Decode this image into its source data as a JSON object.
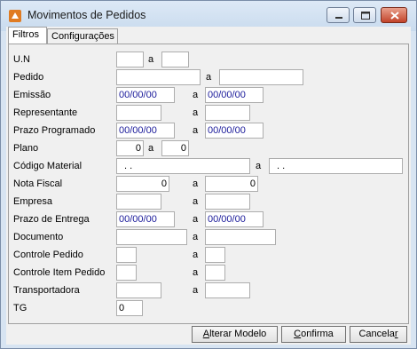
{
  "window": {
    "title": "Movimentos de Pedidos"
  },
  "tabs": [
    {
      "label": "Filtros",
      "active": true
    },
    {
      "label": "Configurações",
      "active": false
    }
  ],
  "range_separator": "a",
  "form": {
    "un": {
      "label": "U.N",
      "from": "",
      "to": ""
    },
    "pedido": {
      "label": "Pedido",
      "from": "",
      "to": ""
    },
    "emissao": {
      "label": "Emissão",
      "from": "00/00/00",
      "to": "00/00/00"
    },
    "representante": {
      "label": "Representante",
      "from": "",
      "to": ""
    },
    "prazo_programado": {
      "label": "Prazo Programado",
      "from": "00/00/00",
      "to": "00/00/00"
    },
    "plano": {
      "label": "Plano",
      "from": "0",
      "to": "0"
    },
    "codigo_material": {
      "label": "Código Material",
      "from": ".  .",
      "to": ".  ."
    },
    "nota_fiscal": {
      "label": "Nota Fiscal",
      "from": "0",
      "to": "0"
    },
    "empresa": {
      "label": "Empresa",
      "from": "",
      "to": ""
    },
    "prazo_entrega": {
      "label": "Prazo de Entrega",
      "from": "00/00/00",
      "to": "00/00/00"
    },
    "documento": {
      "label": "Documento",
      "from": "",
      "to": ""
    },
    "controle_pedido": {
      "label": "Controle Pedido",
      "from": "",
      "to": ""
    },
    "controle_item_pedido": {
      "label": "Controle Item Pedido",
      "from": "",
      "to": ""
    },
    "transportadora": {
      "label": "Transportadora",
      "from": "",
      "to": ""
    },
    "tg": {
      "label": "TG",
      "value": "0"
    }
  },
  "buttons": {
    "alterar_modelo_first": "A",
    "alterar_modelo_rest": "lterar Modelo",
    "confirma_first": "C",
    "confirma_rest": "onfirma",
    "cancelar_main": "Cancela",
    "cancelar_last": "r"
  },
  "colors": {
    "window_frame": "#d7e4f2",
    "date_text": "#1a1a9a",
    "close_button": "#c2442a"
  },
  "icons": [
    "app-icon",
    "minimize-icon",
    "maximize-icon",
    "close-icon"
  ]
}
